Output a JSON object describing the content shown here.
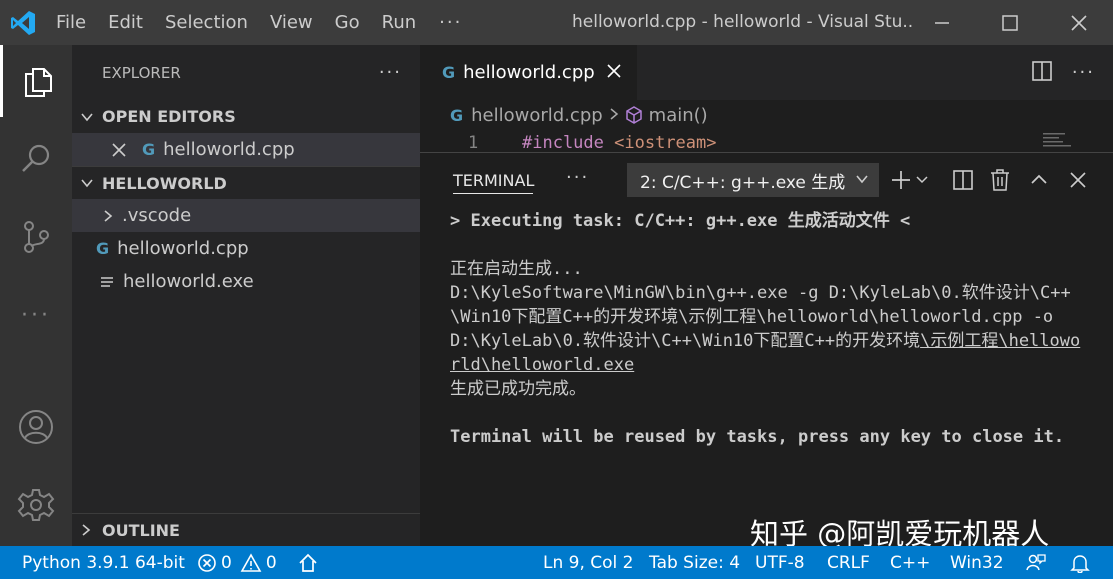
{
  "titlebar": {
    "menu": [
      "File",
      "Edit",
      "Selection",
      "View",
      "Go",
      "Run"
    ],
    "more": "···",
    "window_title": "helloworld.cpp - helloworld - Visual Stu..."
  },
  "activity_bar": {
    "icons": [
      "files-icon",
      "search-icon",
      "source-control-icon",
      "more-icon",
      "account-icon",
      "settings-gear-icon"
    ],
    "more": "···"
  },
  "sidebar": {
    "title": "EXPLORER",
    "more": "···",
    "open_editors_label": "OPEN EDITORS",
    "open_editor_file": "helloworld.cpp",
    "folder_label": "HELLOWORLD",
    "items": [
      {
        "name": ".vscode",
        "type": "folder"
      },
      {
        "name": "helloworld.cpp",
        "type": "cpp"
      },
      {
        "name": "helloworld.exe",
        "type": "file"
      }
    ],
    "outline_label": "OUTLINE"
  },
  "editor": {
    "tab_label": "helloworld.cpp",
    "breadcrumb": {
      "file": "helloworld.cpp",
      "symbol": "main()"
    },
    "line_number": "1",
    "code_keyword": "#include",
    "code_include": "<iostream>"
  },
  "panel": {
    "tab_label": "TERMINAL",
    "more": "···",
    "terminal_select": "2: C/C++: g++.exe 生成",
    "lines": {
      "executing": "> Executing task: C/C++: g++.exe 生成活动文件 <",
      "starting": "正在启动生成...",
      "command": "D:\\KyleSoftware\\MinGW\\bin\\g++.exe -g D:\\KyleLab\\0.软件设计\\C++\\Win10下配置C++的开发环境\\示例工程\\helloworld\\helloworld.cpp -o D:\\KyleLab\\0.软件设计\\C++\\Win10下配置C++的开发环境",
      "command_link": "\\示例工程\\helloworld\\helloworld.exe",
      "success": "生成已成功完成。",
      "reuse": "Terminal will be reused by tasks, press any key to close it."
    },
    "watermark": "知乎 @阿凯爱玩机器人"
  },
  "statusbar": {
    "python": "Python 3.9.1 64-bit",
    "errors": "0",
    "warnings": "0",
    "position": "Ln 9, Col 2",
    "tab_size": "Tab Size: 4",
    "encoding": "UTF-8",
    "eol": "CRLF",
    "language": "C++",
    "platform": "Win32"
  },
  "colors": {
    "titlebar": "#3c3c3c",
    "activitybar": "#333333",
    "sidebar": "#252526",
    "editor": "#1e1e1e",
    "statusbar": "#007acc",
    "vscode_blue": "#23a9f2",
    "cpp_icon": "#519aba"
  }
}
